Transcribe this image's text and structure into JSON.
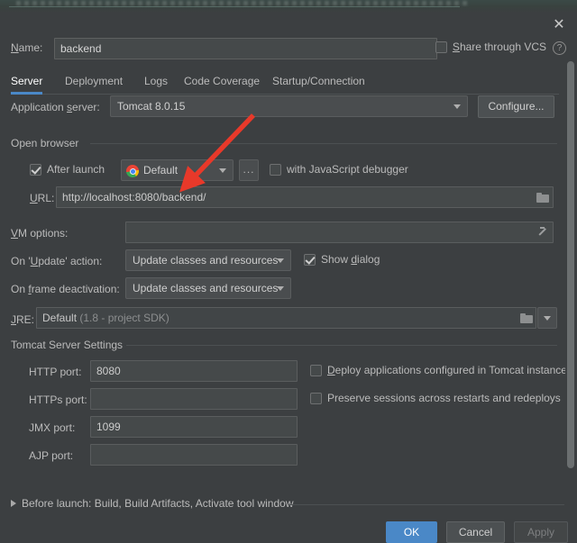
{
  "window": {
    "close_icon": "close-icon",
    "help_icon": "?"
  },
  "name_row": {
    "label": "Name:",
    "label_mnemonic": "N",
    "value": "backend",
    "share_vcs_label": "Share through VCS",
    "share_vcs_mnemonic": "S",
    "share_vcs_checked": false
  },
  "tabs": [
    {
      "label": "Server",
      "active": true
    },
    {
      "label": "Deployment",
      "active": false
    },
    {
      "label": "Logs",
      "active": false
    },
    {
      "label": "Code Coverage",
      "active": false
    },
    {
      "label": "Startup/Connection",
      "active": false
    }
  ],
  "server_tab": {
    "application_server": {
      "label": "Application server:",
      "value": "Tomcat 8.0.15",
      "configure_button": "Configure..."
    },
    "open_browser": {
      "section_title": "Open browser",
      "after_launch_label": "After launch",
      "after_launch_checked": true,
      "browser_value": "Default",
      "browser_icon": "chrome-icon",
      "more_button": "...",
      "js_debugger_label": "with JavaScript debugger",
      "js_debugger_checked": false,
      "url_label": "URL:",
      "url_mnemonic": "U",
      "url_value": "http://localhost:8080/backend/",
      "url_browse_icon": "folder-icon"
    },
    "vm_options": {
      "label": "VM options:",
      "value": "",
      "expand_icon": "expand-icon"
    },
    "on_update_action": {
      "label": "On 'Update' action:",
      "value": "Update classes and resources",
      "show_dialog_label": "Show dialog",
      "show_dialog_checked": true
    },
    "on_frame_deactivation": {
      "label": "On frame deactivation:",
      "value": "Update classes and resources"
    },
    "jre": {
      "label": "JRE:",
      "value": "Default",
      "hint": "(1.8 - project SDK)",
      "browse_icon": "folder-icon"
    },
    "tomcat_server_settings": {
      "section_title": "Tomcat Server Settings",
      "ports": [
        {
          "label": "HTTP port:",
          "value": "8080"
        },
        {
          "label": "HTTPs port:",
          "value": ""
        },
        {
          "label": "JMX port:",
          "value": "1099"
        },
        {
          "label": "AJP port:",
          "value": ""
        }
      ],
      "options": [
        {
          "label": "Deploy applications configured in Tomcat instance",
          "checked": false,
          "mnemonic": "D"
        },
        {
          "label": "Preserve sessions across restarts and redeploys",
          "checked": false,
          "mnemonic": ""
        }
      ]
    }
  },
  "before_launch": {
    "text": "Before launch: Build, Build Artifacts, Activate tool window"
  },
  "footer": {
    "ok": "OK",
    "cancel": "Cancel",
    "apply": "Apply"
  },
  "annotation": {
    "arrow_color": "#e8392a"
  },
  "colors": {
    "background": "#3c3f41",
    "field_background": "#45494a",
    "accent_blue": "#4a88c7",
    "text": "#bbbbbb"
  }
}
